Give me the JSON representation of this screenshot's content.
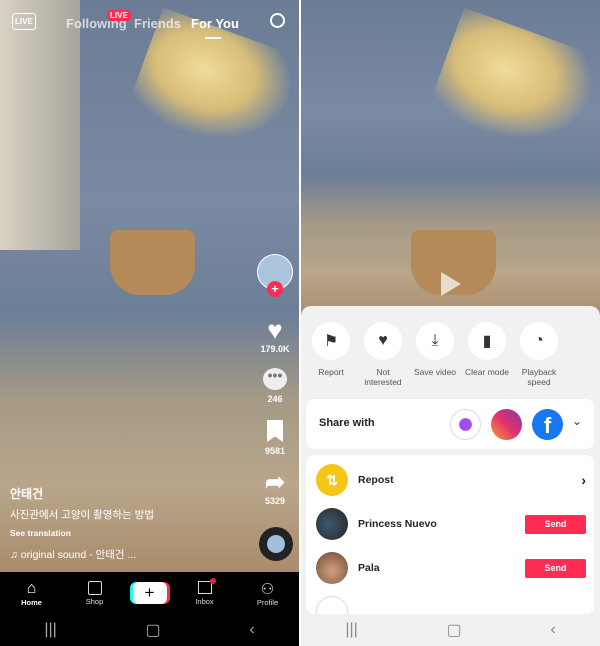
{
  "feed": {
    "tabs": {
      "live": "LIVE",
      "following": "Following",
      "following_badge": "LIVE",
      "friends": "Friends",
      "for_you": "For You"
    },
    "likes": "179.0K",
    "comments": "246",
    "bookmarks": "9581",
    "shares": "5329",
    "username": "안태건",
    "description": "사진관에서 고양이 촬영하는 방법",
    "see_translation": "See translation",
    "sound": "original sound - 안태건 ..."
  },
  "nav": {
    "items": [
      "Home",
      "Shop",
      "Inbox",
      "Profile"
    ],
    "create": "+"
  },
  "share_sheet": {
    "actions": [
      "Report",
      "Not interested",
      "Save video",
      "Clear mode",
      "Playback speed"
    ],
    "share_with": "Share with",
    "apps": [
      "messenger",
      "instagram",
      "facebook"
    ],
    "repost": "Repost",
    "friends": [
      {
        "name": "Princess Nuevo",
        "button": "Send"
      },
      {
        "name": "Pala",
        "button": "Send"
      }
    ]
  },
  "colors": {
    "accent": "#fe2c55",
    "repost": "#f5c518",
    "facebook": "#1877f2"
  }
}
